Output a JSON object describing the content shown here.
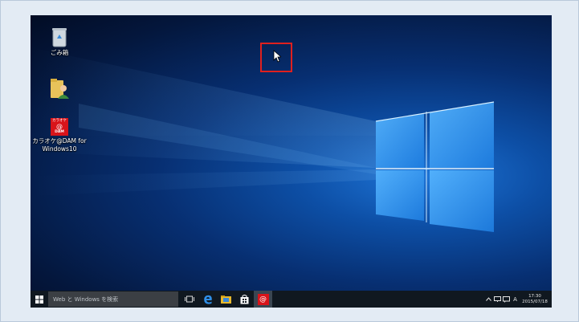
{
  "desktop": {
    "icons": [
      {
        "label": "ごみ箱"
      },
      {
        "label": ""
      },
      {
        "label_line1": "カラオケ@DAM for",
        "label_line2": "Windows10",
        "logo_top": "カラオケ",
        "logo_mid": "@",
        "logo_bot": "DAM"
      }
    ]
  },
  "taskbar": {
    "search_placeholder": "Web と Windows を検索",
    "ime": "A",
    "clock_time": "17:30",
    "clock_date": "2015/07/18"
  },
  "colors": {
    "highlight": "#e0201e",
    "taskbar": "#101820",
    "dam_red": "#d8141a"
  }
}
